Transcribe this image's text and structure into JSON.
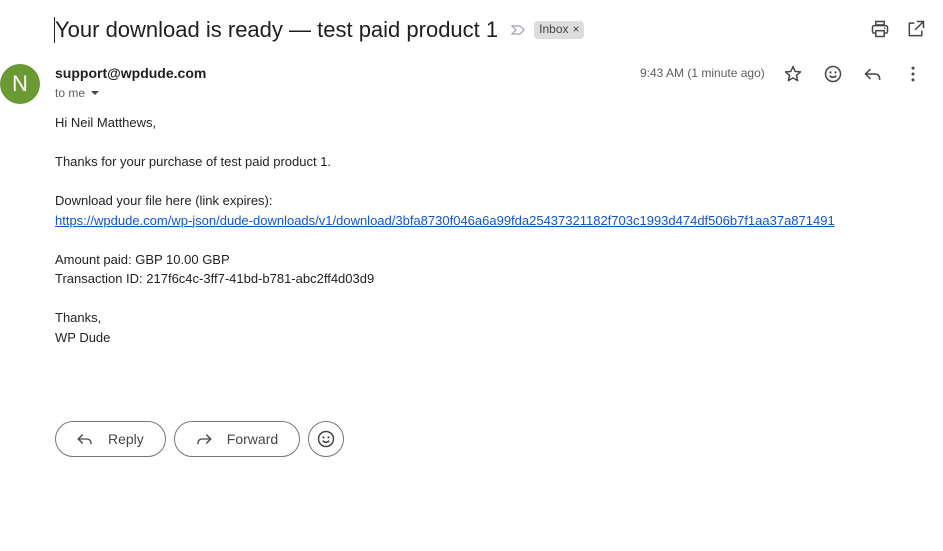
{
  "subject": {
    "title": "Your download is ready — test paid product 1",
    "label_chip": "Inbox",
    "chip_close": "×"
  },
  "toolbar": {
    "print_icon": "print-icon",
    "open_new_window_icon": "open-in-new-window-icon"
  },
  "message": {
    "avatar_letter": "N",
    "avatar_color": "#6b9a35",
    "sender": "support@wpdude.com",
    "recipient": "to me",
    "timestamp": "9:43 AM (1 minute ago)",
    "icons": [
      "star-icon",
      "emoji-icon",
      "reply-icon",
      "more-vert-icon"
    ]
  },
  "body": {
    "greeting": "Hi Neil Matthews,",
    "thanks_line": "Thanks for your purchase of test paid product 1.",
    "download_label": "Download your file here (link expires):",
    "download_link": "https://wpdude.com/wp-json/dude-downloads/v1/download/3bfa8730f046a6a99fda25437321182f703c1993d474df506b7f1aa37a871491",
    "amount": "Amount paid: GBP 10.00 GBP",
    "transaction": "Transaction ID: 217f6c4c-3ff7-41bd-b781-abc2ff4d03d9",
    "signoff": "Thanks,",
    "signature": "WP Dude"
  },
  "actions": {
    "reply_label": "Reply",
    "forward_label": "Forward"
  },
  "colors": {
    "link": "#1155cc",
    "text": "#222222",
    "chip_bg": "#dddddd"
  }
}
